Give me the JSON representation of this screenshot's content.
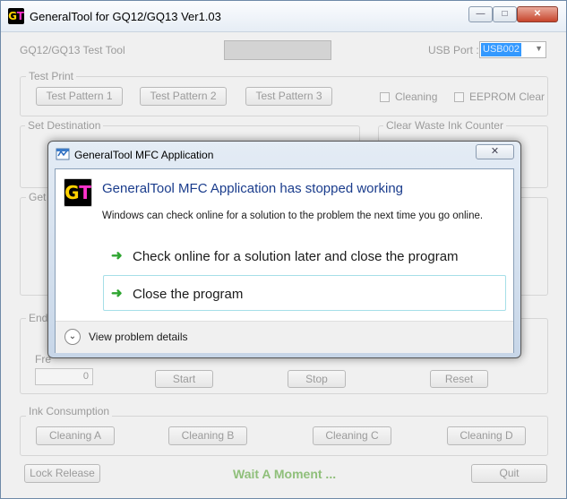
{
  "main": {
    "title": "GeneralTool for GQ12/GQ13 Ver1.03",
    "header_label": "GQ12/GQ13 Test Tool",
    "usb_port_label": "USB Port :",
    "usb_port_value": "USB002",
    "test_print": {
      "label": "Test Print",
      "buttons": [
        "Test Pattern 1",
        "Test Pattern 2",
        "Test Pattern 3"
      ],
      "cleaning_label": "Cleaning",
      "eeprom_label": "EEPROM Clear"
    },
    "set_destination_label": "Set Destination",
    "clear_waste_label": "Clear Waste Ink Counter",
    "get_label": "Get",
    "endurance_label": "Endu",
    "frequency_label": "Fre",
    "frequency_value": "0",
    "endurance_buttons": [
      "Start",
      "Stop",
      "Reset"
    ],
    "ink_consumption": {
      "label": "Ink Consumption",
      "buttons": [
        "Cleaning A",
        "Cleaning B",
        "Cleaning C",
        "Cleaning D"
      ]
    },
    "lock_release": "Lock Release",
    "status": "Wait A Moment ...",
    "quit": "Quit"
  },
  "dialog": {
    "title": "GeneralTool MFC Application",
    "heading": "GeneralTool MFC Application has stopped working",
    "message": "Windows can check online for a solution to the problem the next time you go online.",
    "options": [
      "Check online for a solution later and close the program",
      "Close the program"
    ],
    "details": "View problem details"
  },
  "colors": {
    "status_green": "#8fbf7a",
    "heading_blue": "#1a3c8c",
    "arrow_green": "#2fa531"
  }
}
